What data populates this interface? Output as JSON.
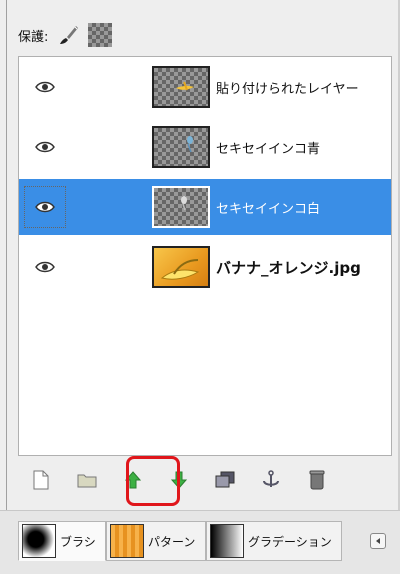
{
  "lock": {
    "label": "保護:"
  },
  "layers": [
    {
      "name": "貼り付けられたレイヤー",
      "visible": true,
      "selected": false
    },
    {
      "name": "セキセイインコ青",
      "visible": true,
      "selected": false
    },
    {
      "name": "セキセイインコ白",
      "visible": true,
      "selected": true
    },
    {
      "name": "バナナ_オレンジ.jpg",
      "visible": true,
      "selected": false
    }
  ],
  "toolbar": {
    "buttons": [
      "new-layer",
      "new-layer-group",
      "raise-layer",
      "lower-layer",
      "duplicate-layer",
      "anchor-layer",
      "delete-layer"
    ],
    "highlighted": "raise-layer"
  },
  "tabs": [
    {
      "label": "ブラシ"
    },
    {
      "label": "パターン"
    },
    {
      "label": "グラデーション"
    }
  ],
  "colors": {
    "selection": "#3a8ee6",
    "highlight": "#e0161b",
    "raise_arrow": "#3cb043"
  }
}
